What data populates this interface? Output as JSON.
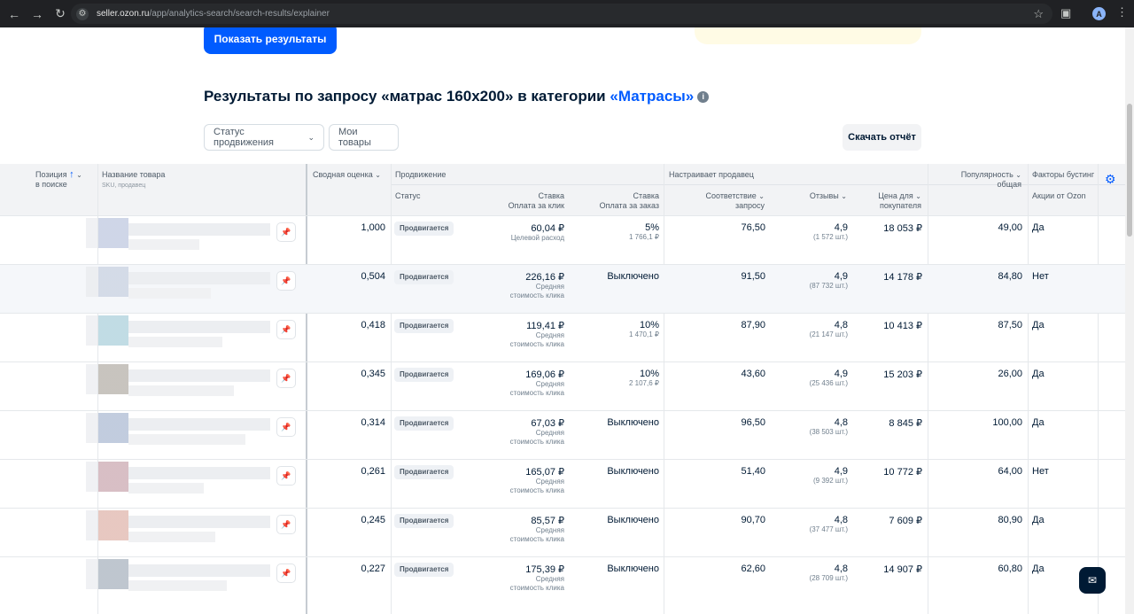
{
  "browser": {
    "url_host": "seller.ozon.ru",
    "url_path": "/app/analytics-search/search-results/explainer",
    "profile_initial": "A",
    "icons": [
      "back-icon",
      "forward-icon",
      "reload-icon",
      "site-info-icon",
      "star-icon",
      "extensions-icon",
      "menu-icon"
    ]
  },
  "top": {
    "show_results_label": "Показать результаты"
  },
  "results": {
    "title_prefix": "Результаты по запросу «матрас 160x200» в категории ",
    "category": "«Матрасы»",
    "info": "i"
  },
  "filters": {
    "status_label": "Статус продвижения",
    "my_products_label": "Мои товары",
    "download_label": "Скачать отчёт"
  },
  "table": {
    "headers": {
      "position": "Позиция",
      "position_sub": "в поиске",
      "product_name": "Название товара",
      "product_sub": "SKU, продавец",
      "summary_score": "Сводная оценка",
      "promotion": "Продвижение",
      "status": "Статус",
      "bid_click_1": "Ставка",
      "bid_click_2": "Оплата за клик",
      "bid_order_1": "Ставка",
      "bid_order_2": "Оплата за заказ",
      "seller_configures": "Настраивает продавец",
      "relevance_1": "Соответствие",
      "relevance_2": "запросу",
      "reviews": "Отзывы",
      "price_1": "Цена для",
      "price_2": "покупателя",
      "popularity_1": "Популярность",
      "popularity_2": "общая",
      "boost_factors": "Факторы бустинг",
      "ozon_promos": "Акции от Ozon"
    },
    "rows": [
      {
        "score": "1,000",
        "status": "Продвигается",
        "bid_click": "60,04 ₽",
        "bid_click_note1": "Целевой расход",
        "bid_click_note2": "",
        "bid_order": "5%",
        "bid_order_note": "1 766,1 ₽",
        "relevance": "76,50",
        "rating": "4,9",
        "reviews_count": "(1 572 шт.)",
        "price": "18 053 ₽",
        "popularity": "49,00",
        "promo": "Да"
      },
      {
        "score": "0,504",
        "status": "Продвигается",
        "bid_click": "226,16 ₽",
        "bid_click_note1": "Средняя",
        "bid_click_note2": "стоимость клика",
        "bid_order": "Выключено",
        "bid_order_note": "",
        "relevance": "91,50",
        "rating": "4,9",
        "reviews_count": "(87 732 шт.)",
        "price": "14 178 ₽",
        "popularity": "84,80",
        "promo": "Нет"
      },
      {
        "score": "0,418",
        "status": "Продвигается",
        "bid_click": "119,41 ₽",
        "bid_click_note1": "Средняя",
        "bid_click_note2": "стоимость клика",
        "bid_order": "10%",
        "bid_order_note": "1 470,1 ₽",
        "relevance": "87,90",
        "rating": "4,8",
        "reviews_count": "(21 147 шт.)",
        "price": "10 413 ₽",
        "popularity": "87,50",
        "promo": "Да"
      },
      {
        "score": "0,345",
        "status": "Продвигается",
        "bid_click": "169,06 ₽",
        "bid_click_note1": "Средняя",
        "bid_click_note2": "стоимость клика",
        "bid_order": "10%",
        "bid_order_note": "2 107,6 ₽",
        "relevance": "43,60",
        "rating": "4,9",
        "reviews_count": "(25 436 шт.)",
        "price": "15 203 ₽",
        "popularity": "26,00",
        "promo": "Да"
      },
      {
        "score": "0,314",
        "status": "Продвигается",
        "bid_click": "67,03 ₽",
        "bid_click_note1": "Средняя",
        "bid_click_note2": "стоимость клика",
        "bid_order": "Выключено",
        "bid_order_note": "",
        "relevance": "96,50",
        "rating": "4,8",
        "reviews_count": "(38 503 шт.)",
        "price": "8 845 ₽",
        "popularity": "100,00",
        "promo": "Да"
      },
      {
        "score": "0,261",
        "status": "Продвигается",
        "bid_click": "165,07 ₽",
        "bid_click_note1": "Средняя",
        "bid_click_note2": "стоимость клика",
        "bid_order": "Выключено",
        "bid_order_note": "",
        "relevance": "51,40",
        "rating": "4,9",
        "reviews_count": "(9 392 шт.)",
        "price": "10 772 ₽",
        "popularity": "64,00",
        "promo": "Нет"
      },
      {
        "score": "0,245",
        "status": "Продвигается",
        "bid_click": "85,57 ₽",
        "bid_click_note1": "Средняя",
        "bid_click_note2": "стоимость клика",
        "bid_order": "Выключено",
        "bid_order_note": "",
        "relevance": "90,70",
        "rating": "4,8",
        "reviews_count": "(37 477 шт.)",
        "price": "7 609 ₽",
        "popularity": "80,90",
        "promo": "Да"
      },
      {
        "score": "0,227",
        "status": "Продвигается",
        "bid_click": "175,39 ₽",
        "bid_click_note1": "Средняя",
        "bid_click_note2": "стоимость клика",
        "bid_order": "Выключено",
        "bid_order_note": "",
        "relevance": "62,60",
        "rating": "4,8",
        "reviews_count": "(28 709 шт.)",
        "price": "14 907 ₽",
        "popularity": "60,80",
        "promo": "Да"
      }
    ],
    "thumb_colors": [
      "#a8b4d4",
      "#b8c4d8",
      "#8ec0cf",
      "#9a938a",
      "#8fa3c4",
      "#b98a95",
      "#d49a8e",
      "#8a98a8"
    ]
  }
}
